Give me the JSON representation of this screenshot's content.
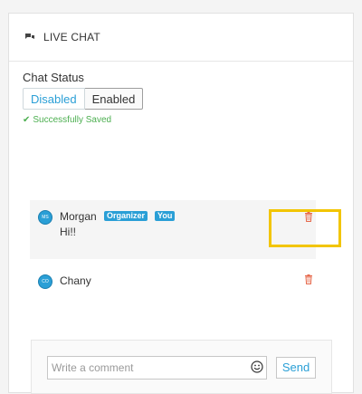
{
  "header": {
    "icon": "chat-bubbles-icon",
    "title": "LIVE CHAT"
  },
  "status": {
    "label": "Chat Status",
    "options": [
      "Disabled",
      "Enabled"
    ],
    "selected": "Enabled",
    "saved_message": "Successfully Saved"
  },
  "messages": [
    {
      "initials": "MS",
      "name": "Morgan",
      "badges": [
        "Organizer",
        "You"
      ],
      "text": "Hi!!"
    },
    {
      "initials": "CO",
      "name": "Chany",
      "badges": [],
      "text": ""
    }
  ],
  "composer": {
    "placeholder": "Write a comment",
    "send_label": "Send"
  },
  "colors": {
    "accent": "#2a9fd6",
    "success": "#4caf50",
    "delete": "#e66a4d",
    "highlight": "#f2c500"
  }
}
